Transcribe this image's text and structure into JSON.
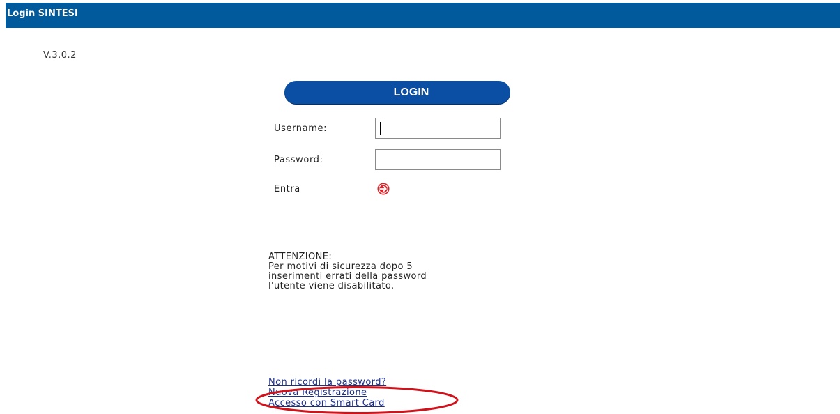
{
  "window": {
    "title": "Login SINTESI"
  },
  "version": "V.3.0.2",
  "login": {
    "header": "LOGIN",
    "username_label": "Username:",
    "username_value": "",
    "password_label": "Password:",
    "password_value": "",
    "enter_label": "Entra",
    "enter_icon": "arrow-right-circle-icon"
  },
  "warning": {
    "lines": [
      "ATTENZIONE:",
      "Per motivi di sicurezza dopo 5",
      "inserimenti errati della password",
      "l'utente viene disabilitato."
    ]
  },
  "links": [
    "Non ricordi la password?",
    "Nuova Registrazione",
    "Accesso con Smart Card"
  ],
  "colors": {
    "titlebar": "#005a9c",
    "login_header": "#0a4fa3",
    "enter_icon": "#d7262b",
    "link": "#1c2f8a",
    "annotation": "#d0121b"
  }
}
